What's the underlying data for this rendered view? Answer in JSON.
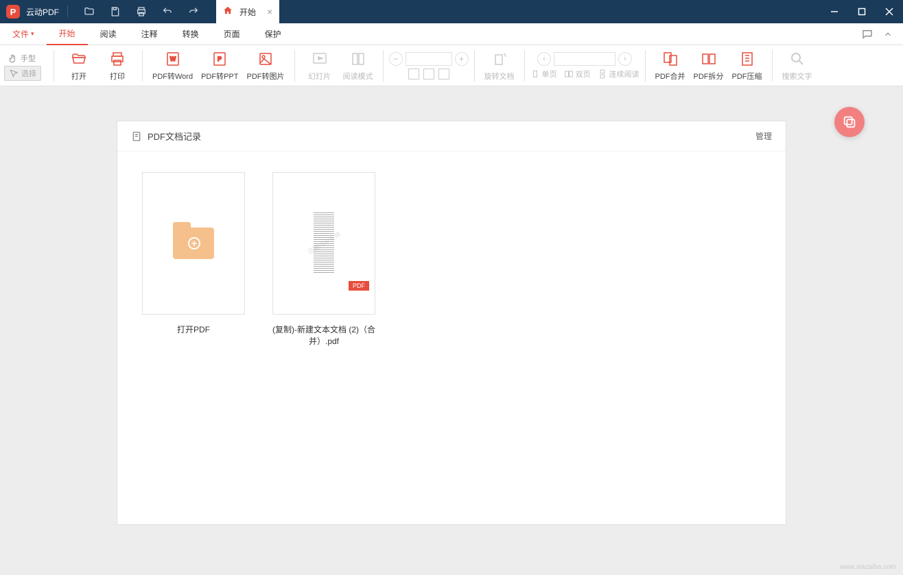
{
  "app": {
    "name": "云动PDF"
  },
  "tab": {
    "label": "开始"
  },
  "menu": {
    "file": "文件",
    "start": "开始",
    "read": "阅读",
    "annotate": "注释",
    "convert": "转换",
    "page": "页面",
    "protect": "保护"
  },
  "tools": {
    "hand": "手型",
    "select": "选择",
    "open": "打开",
    "print": "打印",
    "toword": "PDF转Word",
    "toppt": "PDF转PPT",
    "toimage": "PDF转图片",
    "slideshow": "幻灯片",
    "readmode": "阅读模式",
    "rotate": "旋转文档",
    "single": "单页",
    "double": "双页",
    "continuous": "连续阅读",
    "merge": "PDF合并",
    "split": "PDF拆分",
    "compress": "PDF压缩",
    "search": "搜索文字"
  },
  "panel": {
    "title": "PDF文档记录",
    "manage": "管理"
  },
  "cards": {
    "open": "打开PDF",
    "file1": "(复制)-新建文本文档 (2)（合并）.pdf",
    "badge": "PDF",
    "watermark": "迅捷PDF大师"
  },
  "watermark": "www.xiazaiba.com"
}
